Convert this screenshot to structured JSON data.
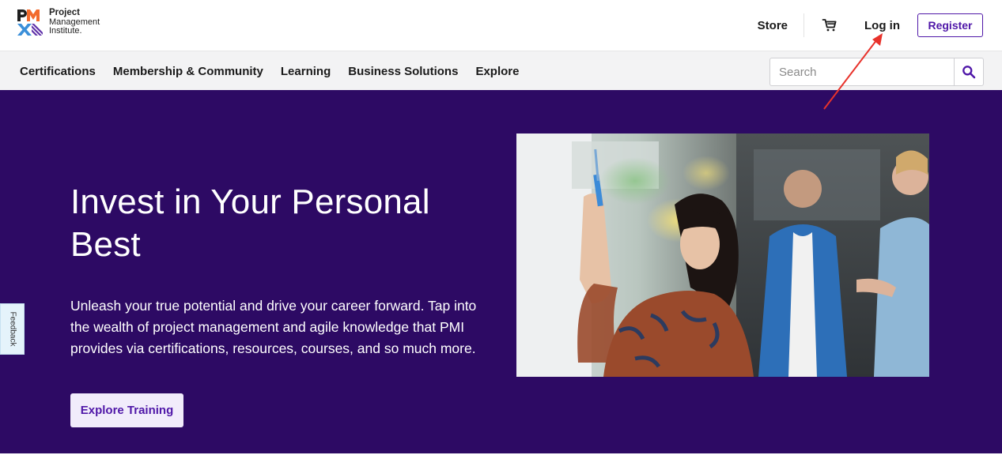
{
  "header": {
    "logo": {
      "letters": "PMI",
      "line1": "Project",
      "line2": "Management",
      "line3": "Institute."
    },
    "store_label": "Store",
    "cart_icon": "cart-icon",
    "login_label": "Log in",
    "register_label": "Register"
  },
  "nav": {
    "items": [
      {
        "label": "Certifications"
      },
      {
        "label": "Membership & Community"
      },
      {
        "label": "Learning"
      },
      {
        "label": "Business Solutions"
      },
      {
        "label": "Explore"
      }
    ],
    "search": {
      "placeholder": "Search",
      "icon": "search-icon"
    }
  },
  "hero": {
    "title": "Invest in Your Personal Best",
    "body": "Unleash your true potential and drive your career forward. Tap into the wealth of project management and agile knowledge that PMI provides via certifications, resources, courses, and so much more.",
    "cta_label": "Explore Training",
    "feedback_label": "Feedback"
  },
  "colors": {
    "brand_purple": "#4f17a8",
    "hero_background": "#2d0a64",
    "nav_background": "#f3f3f4",
    "annotation_arrow": "#e8322b"
  }
}
